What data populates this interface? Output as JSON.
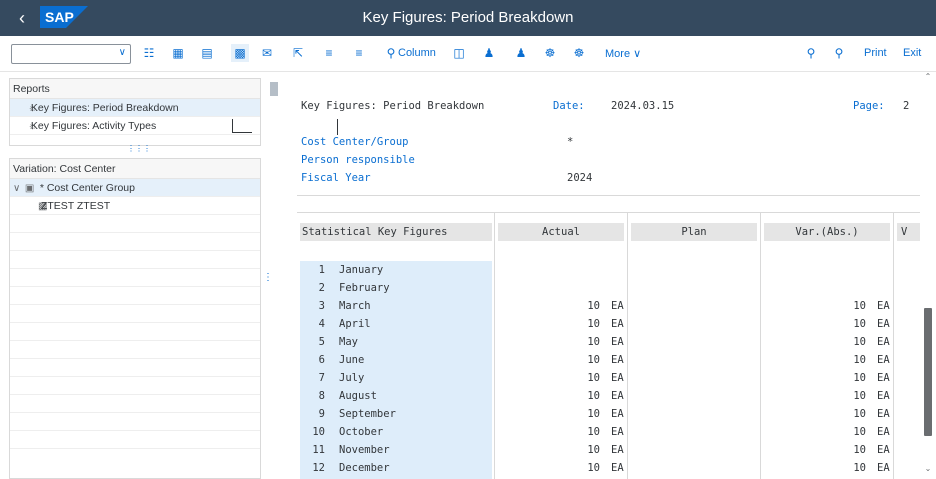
{
  "window": {
    "title": "Key Figures: Period Breakdown",
    "back_icon": "back-chevron-icon",
    "logo": "SAP"
  },
  "toolbar": {
    "select_value": "",
    "column_label": "Column",
    "more_label": "More",
    "print_label": "Print",
    "exit_label": "Exit"
  },
  "left": {
    "reports_header": "Reports",
    "reports": [
      {
        "label": "Key Figures: Period Breakdown"
      },
      {
        "label": "Key Figures: Activity Types"
      }
    ],
    "variation_header": "Variation: Cost Center",
    "group_label": "* Cost Center Group",
    "child_label": "ZTEST ZTEST"
  },
  "report": {
    "title": "Key Figures: Period Breakdown",
    "date_label": "Date:",
    "date_value": "2024.03.15",
    "page_label": "Page:",
    "page_value": "2",
    "fields": [
      {
        "label": "Cost Center/Group",
        "value": "*"
      },
      {
        "label": "Person responsible",
        "value": ""
      },
      {
        "label": "Fiscal Year",
        "value": "2024"
      }
    ],
    "columns": [
      "Statistical Key Figures",
      "Actual",
      "Plan",
      "Var.(Abs.)",
      "V"
    ],
    "rows": [
      {
        "num": "1",
        "month": "January",
        "actual": "",
        "actual_unit": "",
        "var": "",
        "var_unit": ""
      },
      {
        "num": "2",
        "month": "February",
        "actual": "",
        "actual_unit": "",
        "var": "",
        "var_unit": ""
      },
      {
        "num": "3",
        "month": "March",
        "actual": "10",
        "actual_unit": "EA",
        "var": "10",
        "var_unit": "EA"
      },
      {
        "num": "4",
        "month": "April",
        "actual": "10",
        "actual_unit": "EA",
        "var": "10",
        "var_unit": "EA"
      },
      {
        "num": "5",
        "month": "May",
        "actual": "10",
        "actual_unit": "EA",
        "var": "10",
        "var_unit": "EA"
      },
      {
        "num": "6",
        "month": "June",
        "actual": "10",
        "actual_unit": "EA",
        "var": "10",
        "var_unit": "EA"
      },
      {
        "num": "7",
        "month": "July",
        "actual": "10",
        "actual_unit": "EA",
        "var": "10",
        "var_unit": "EA"
      },
      {
        "num": "8",
        "month": "August",
        "actual": "10",
        "actual_unit": "EA",
        "var": "10",
        "var_unit": "EA"
      },
      {
        "num": "9",
        "month": "September",
        "actual": "10",
        "actual_unit": "EA",
        "var": "10",
        "var_unit": "EA"
      },
      {
        "num": "10",
        "month": "October",
        "actual": "10",
        "actual_unit": "EA",
        "var": "10",
        "var_unit": "EA"
      },
      {
        "num": "11",
        "month": "November",
        "actual": "10",
        "actual_unit": "EA",
        "var": "10",
        "var_unit": "EA"
      },
      {
        "num": "12",
        "month": "December",
        "actual": "10",
        "actual_unit": "EA",
        "var": "10",
        "var_unit": "EA"
      }
    ]
  }
}
